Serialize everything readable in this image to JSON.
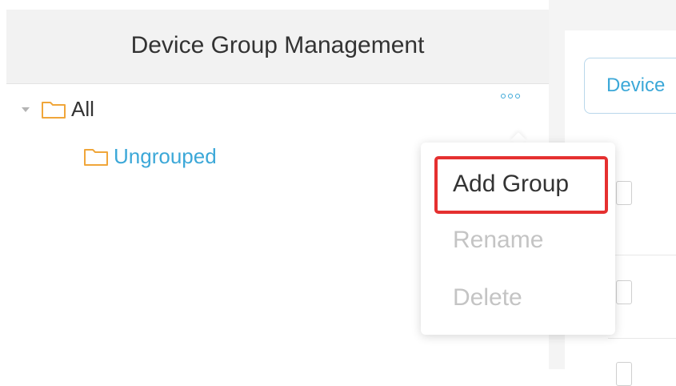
{
  "panel": {
    "title": "Device Group Management"
  },
  "tree": {
    "root_label": "All",
    "children": [
      {
        "label": "Ungrouped"
      }
    ]
  },
  "toolbar": {
    "device_button_label": "Device"
  },
  "context_menu": {
    "items": [
      {
        "label": "Add Group",
        "state": "enabled"
      },
      {
        "label": "Rename",
        "state": "disabled"
      },
      {
        "label": "Delete",
        "state": "disabled"
      }
    ]
  },
  "colors": {
    "accent": "#3ca8d8",
    "folder": "#f0a63a",
    "highlight": "#e53030",
    "disabled_text": "#c4c4c4"
  },
  "icons": [
    "caret-down-icon",
    "folder-icon",
    "more-icon"
  ]
}
